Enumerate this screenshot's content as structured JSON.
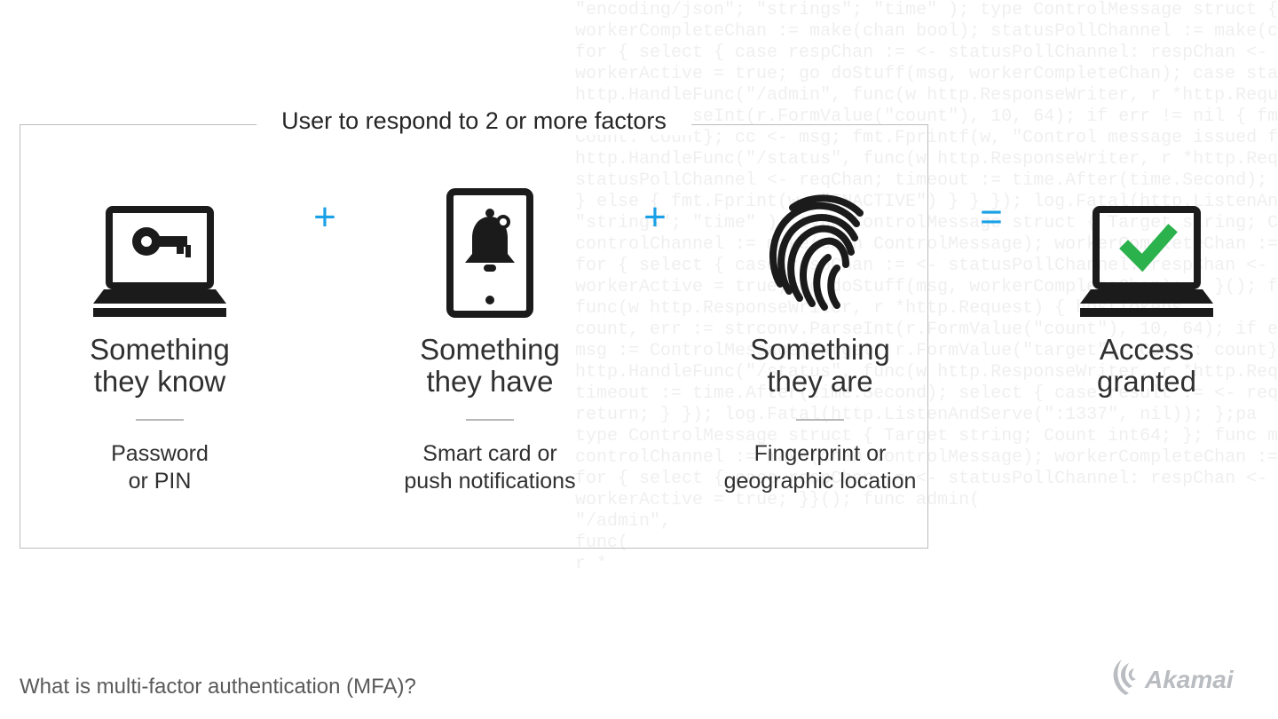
{
  "box_legend": "User to respond to 2 or more factors",
  "operators": {
    "plus": "+",
    "equals": "="
  },
  "factors": [
    {
      "icon": "laptop-key-icon",
      "title": "Something\nthey know",
      "sub": "Password\nor PIN"
    },
    {
      "icon": "phone-bell-icon",
      "title": "Something\nthey have",
      "sub": "Smart card or\npush notifications"
    },
    {
      "icon": "fingerprint-icon",
      "title": "Something\nthey are",
      "sub": "Fingerprint or\ngeographic location"
    }
  ],
  "result": {
    "icon": "laptop-check-icon",
    "title": "Access\ngranted"
  },
  "caption": "What is multi-factor authentication (MFA)?",
  "logo_text": "Akamai",
  "colors": {
    "accent_blue": "#1aa0e6",
    "check_green": "#2bb24c",
    "ink": "#1b1b1b"
  },
  "bg_code": "         \"encoding/json\"; \"strings\"; \"time\" ); type ControlMessage struct { Target string; Co\n         workerCompleteChan := make(chan bool); statusPollChannel := make(chan chan bool);\n         for { select { case respChan := <- statusPollChannel: respChan <- workerActive; case\n         workerActive = true; go doStuff(msg, workerCompleteChan); case status := <- workerCompleteChan: workerActive = status;\n         http.HandleFunc(\"/admin\", func(w http.ResponseWriter, r *http.Request) { hostTo\n         strconv.ParseInt(r.FormValue(\"count\"), 10, 64); if err != nil { fmt.Fprintf(w,\n         Count: count}; cc <- msg; fmt.Fprintf(w, \"Control message issued for Ta\n         http.HandleFunc(\"/status\", func(w http.ResponseWriter, r *http.Request) { reqChan\n         statusPollChannel <- reqChan; timeout := time.After(time.Second); select { case result := <- reqChan: if result { fmt.Fprint(w, \"ACTIVE\"\n         } else { fmt.Fprint(w, \"INACTIVE\") } } }); log.Fatal(http.ListenAndServe(\":1337\", nil)); };pa\n         \"strings\"; \"time\" ); type ControlMessage struct { Target string; Count int64; }; func ma\n         controlChannel := make(chan ControlMessage); workerCompleteChan := make(chan bool); workerAct\n         for { select { case respChan := <- statusPollChannel: respChan <- workerActive; case msg := <\n         workerActive = true; go doStuff(msg, workerCompleteChan); } }(); func admin(\n         func(w http.ResponseWriter, r *http.Request) { hostTokens\n         count, err := strconv.ParseInt(r.FormValue(\"count\"), 10, 64); if err != nil { fmt.Fprintf(w,\n         msg := ControlMessage{Target: r.FormValue(\"target\"), Count: count}; cc <- msg; fmt.Fprintf(w, \"Control message issued for Ta\n         http.HandleFunc(\"/status\", func(w http.ResponseWriter, r *http.Request) { reqChan\n         timeout := time.After(time.Second); select { case result := <- reqChan: if result { fmt.Fprint(w, \"ACTIVE\"\n         return; } }); log.Fatal(http.ListenAndServe(\":1337\", nil)); };pa\n         type ControlMessage struct { Target string; Count int64; }; func ma\n         controlChannel := make(chan ControlMessage); workerCompleteChan := make(chan bool); workerAct\n         for { select { case respChan := <- statusPollChannel: respChan <- workerActive; case msg := <\n         workerActive = true; }}(); func admin(\n         \"/admin\",\n         func(\n         r *"
}
